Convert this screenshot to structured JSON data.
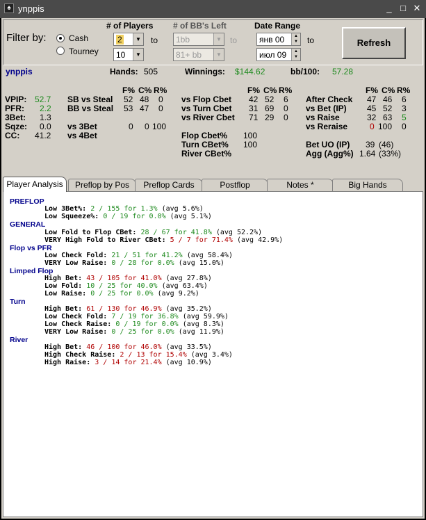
{
  "window": {
    "title": "ynppis",
    "icon": "poker-spade-icon",
    "minimize": "_",
    "maximize": "□",
    "close": "✕"
  },
  "filter": {
    "label": "Filter by:",
    "cash_label": "Cash",
    "tourney_label": "Tourney",
    "players_header": "# of Players",
    "players_from": "2",
    "players_to_label": "to",
    "players_to": "10",
    "bb_header": "# of BB's Left",
    "bb_from": "1bb",
    "bb_to_label": "to",
    "bb_to": "81+ bb",
    "date_header": "Date Range",
    "date_from": "янв 00",
    "date_to_label": "to",
    "date_to": "июл 09",
    "refresh": "Refresh"
  },
  "summary": {
    "player": "ynppis",
    "hands_label": "Hands:",
    "hands": "505",
    "winnings_label": "Winnings:",
    "winnings": "$144.62",
    "bb100_label": "bb/100:",
    "bb100": "57.28"
  },
  "stats": {
    "col_f": "F%",
    "col_c": "C%",
    "col_r": "R%",
    "vpip_label": "VPIP:",
    "vpip": "52.7",
    "pfr_label": "PFR:",
    "pfr": "2.2",
    "threebet_label": "3Bet:",
    "threebet": "1.3",
    "sqze_label": "Sqze:",
    "sqze": "0.0",
    "cc_label": "CC:",
    "cc": "41.2",
    "steal": [
      {
        "label": "SB vs Steal",
        "f": "52",
        "c": "48",
        "r": "0"
      },
      {
        "label": "BB vs Steal",
        "f": "53",
        "c": "47",
        "r": "0"
      }
    ],
    "vs3bet": {
      "label": "vs 3Bet",
      "f": "0",
      "c": "0",
      "r": "100"
    },
    "vs4bet": {
      "label": "vs 4Bet"
    },
    "cbet": [
      {
        "label": "vs Flop Cbet",
        "f": "42",
        "c": "52",
        "r": "6"
      },
      {
        "label": "vs Turn Cbet",
        "f": "31",
        "c": "69",
        "r": "0"
      },
      {
        "label": "vs River Cbet",
        "f": "71",
        "c": "29",
        "r": "0"
      }
    ],
    "flop_cbet_label": "Flop Cbet%",
    "flop_cbet": "100",
    "turn_cbet_label": "Turn CBet%",
    "turn_cbet": "100",
    "river_cbet_label": "River CBet%",
    "after": [
      {
        "label": "After Check",
        "f": "47",
        "c": "46",
        "r": "6"
      },
      {
        "label": "vs Bet (IP)",
        "f": "45",
        "c": "52",
        "r": "3"
      },
      {
        "label": "vs Raise",
        "f": "32",
        "c": "63",
        "r": "5"
      },
      {
        "label": "vs Reraise",
        "f": "0",
        "c": "100",
        "r": "0"
      }
    ],
    "betuo_label": "Bet UO (IP)",
    "betuo": "39",
    "betuo_ip": "(46)",
    "agg_label": "Agg (Agg%)",
    "agg": "1.64",
    "agg_pct": "(33%)"
  },
  "tabs": [
    "Player Analysis",
    "Preflop by Pos",
    "Preflop Cards",
    "Postflop",
    "Notes *",
    "Big Hands"
  ],
  "analysis": {
    "preflop": "PREFLOP",
    "preflop_rows": [
      {
        "label": "Low 3Bet%:",
        "value": "2 / 155 for 1.3%",
        "avg": "(avg 5.6%)"
      },
      {
        "label": "Low Squeeze%:",
        "value": "0 / 19 for 0.0%",
        "avg": "(avg 5.1%)"
      }
    ],
    "general": "GENERAL",
    "general_rows": [
      {
        "label": "Low Fold to Flop CBet:",
        "value": "28 / 67 for 41.8%",
        "avg": "(avg 52.2%)"
      },
      {
        "label": "VERY High Fold to River CBet:",
        "value": "5 / 7 for 71.4%",
        "avg": "(avg 42.9%)"
      }
    ],
    "flopvspfr": "Flop vs PFR",
    "flopvspfr_rows": [
      {
        "label": "Low Check Fold:",
        "value": "21 / 51 for 41.2%",
        "avg": "(avg 58.4%)"
      },
      {
        "label": "VERY Low Raise:",
        "value": "0 / 28 for 0.0%",
        "avg": "(avg 15.0%)"
      }
    ],
    "limped": "Limped Flop",
    "limped_rows": [
      {
        "label": "High Bet:",
        "value": "43 / 105 for 41.0%",
        "avg": "(avg 27.8%)"
      },
      {
        "label": "Low Fold:",
        "value": "10 / 25 for 40.0%",
        "avg": "(avg 63.4%)"
      },
      {
        "label": "Low Raise:",
        "value": "0 / 25 for 0.0%",
        "avg": "(avg 9.2%)"
      }
    ],
    "turn": "Turn",
    "turn_rows": [
      {
        "label": "High Bet:",
        "value": "61 / 130 for 46.9%",
        "avg": "(avg 35.2%)"
      },
      {
        "label": "Low Check Fold:",
        "value": "7 / 19 for 36.8%",
        "avg": "(avg 59.9%)"
      },
      {
        "label": "Low Check Raise:",
        "value": "0 / 19 for 0.0%",
        "avg": "(avg 8.3%)"
      },
      {
        "label": "VERY Low Raise:",
        "value": "0 / 25 for 0.0%",
        "avg": "(avg 11.9%)"
      }
    ],
    "river": "River",
    "river_rows": [
      {
        "label": "High Bet:",
        "value": "46 / 100 for 46.0%",
        "avg": "(avg 33.5%)"
      },
      {
        "label": "High Check Raise:",
        "value": "2 / 13 for 15.4%",
        "avg": "(avg 3.4%)"
      },
      {
        "label": "High Raise:",
        "value": "3 / 14 for 21.4%",
        "avg": "(avg 10.9%)"
      }
    ]
  }
}
